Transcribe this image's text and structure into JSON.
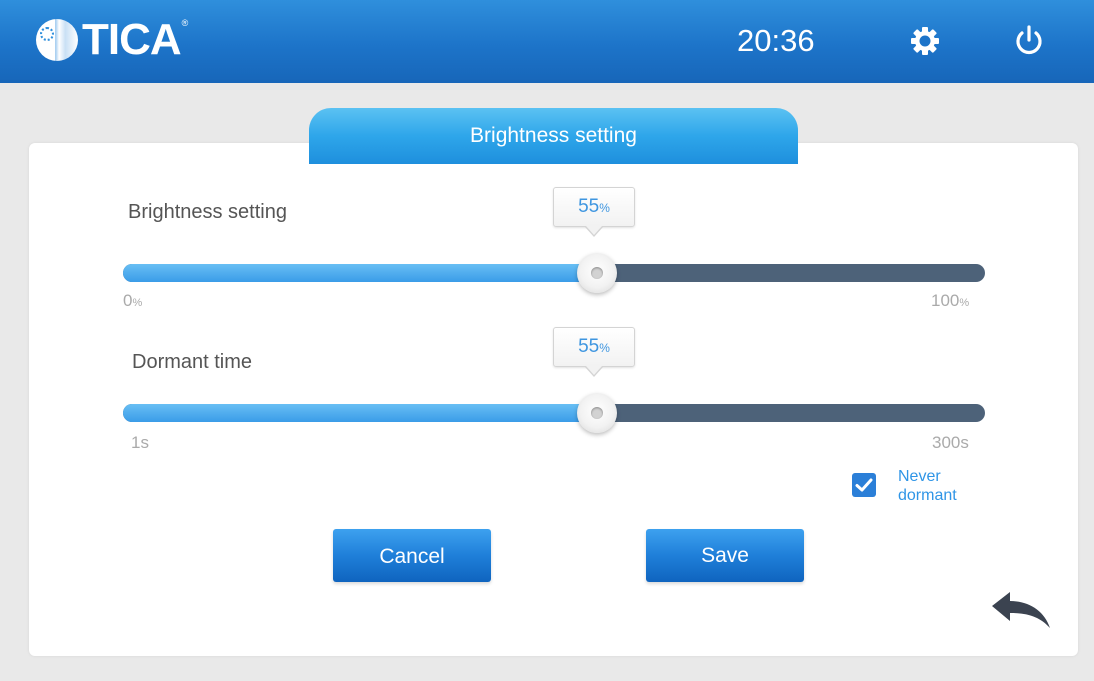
{
  "header": {
    "brand": "TICA",
    "brand_mark": "®",
    "time": "20:36",
    "icons": [
      "settings-gear-icon",
      "power-icon"
    ]
  },
  "panel": {
    "tab_title": "Brightness setting"
  },
  "brightness": {
    "label": "Brightness setting",
    "value": 55,
    "value_text": "55",
    "value_unit": "%",
    "min_text": "0",
    "min_unit": "%",
    "max_text": "100",
    "max_unit": "%"
  },
  "dormant": {
    "label": "Dormant time",
    "value": 55,
    "value_text": "55",
    "value_unit": "%",
    "min_text": "1s",
    "max_text": "300s",
    "never_dormant_checked": true,
    "never_dormant_line1": "Never",
    "never_dormant_line2": "dormant"
  },
  "buttons": {
    "cancel": "Cancel",
    "save": "Save",
    "back_icon": "back-arrow-icon"
  },
  "colors": {
    "header_blue": "#1d74c9",
    "accent_blue": "#3a9ce8",
    "track_dark": "#4d6279"
  }
}
